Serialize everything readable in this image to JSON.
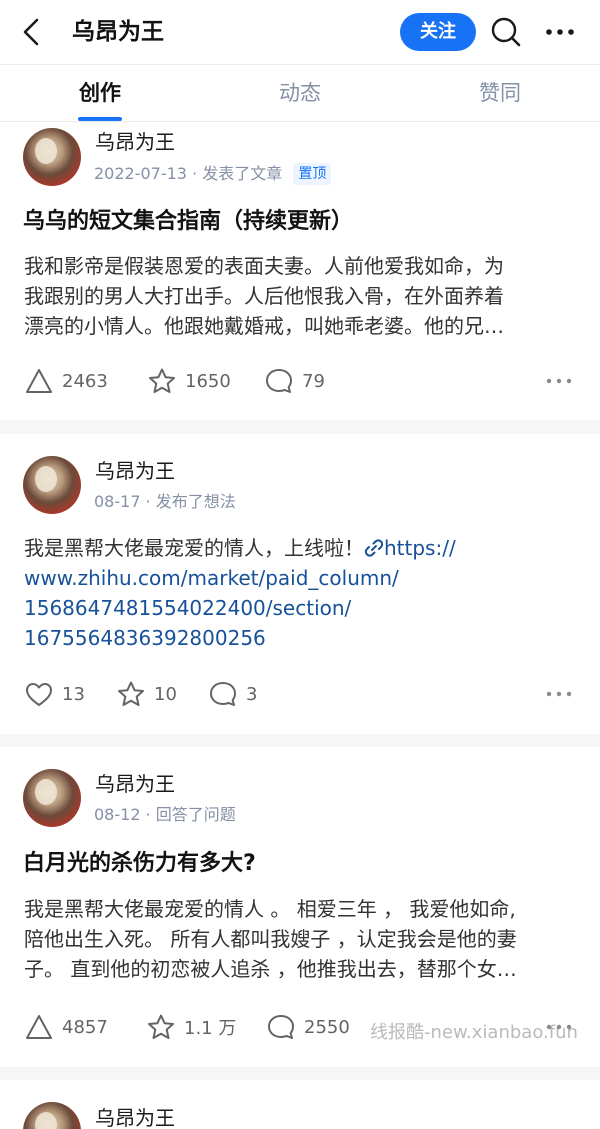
{
  "header": {
    "title": "乌昂为王",
    "follow_label": "关注",
    "icons": {
      "back": "back-arrow-icon",
      "search": "search-icon",
      "more": "more-dots-icon"
    }
  },
  "tabs": [
    {
      "label": "创作",
      "active": true
    },
    {
      "label": "动态",
      "active": false
    },
    {
      "label": "赞同",
      "active": false
    }
  ],
  "colors": {
    "accent": "#1772f6",
    "link": "#175199",
    "meta": "#8590a6"
  },
  "feed": [
    {
      "author": "乌昂为王",
      "date": "2022-07-13",
      "action": "发表了文章",
      "badge": "置顶",
      "title": "乌乌的短文集合指南（持续更新）",
      "excerpt_lines": [
        "我和影帝是假装恩爱的表面夫妻。人前他爱我如命，为",
        "我跟别的男人大打出手。人后他恨我入骨，在外面养着",
        "漂亮的小情人。他跟她戴婚戒，叫她乖老婆。他的兄…"
      ],
      "stats": {
        "primary_icon": "upvote-triangle-icon",
        "primary": "2463",
        "collect": "1650",
        "comment": "79"
      }
    },
    {
      "author": "乌昂为王",
      "date": "08-17",
      "action": "发布了想法",
      "text_prefix": "我是黑帮大佬最宠爱的情人，上线啦！",
      "link_lines": [
        "https://",
        "www.zhihu.com/market/paid_column/",
        "1568647481554022400/section/",
        "1675564836392800256"
      ],
      "stats": {
        "primary_icon": "heart-icon",
        "primary": "13",
        "collect": "10",
        "comment": "3"
      }
    },
    {
      "author": "乌昂为王",
      "date": "08-12",
      "action": "回答了问题",
      "title": "白月光的杀伤力有多大?",
      "excerpt_lines": [
        "我是黑帮大佬最宠爱的情人 。 相爱三年 ， 我爱他如命,",
        "陪他出生入死。 所有人都叫我嫂子 ，认定我会是他的妻",
        "子。 直到他的初恋被人追杀 ，他推我出去，替那个女…"
      ],
      "stats": {
        "primary_icon": "upvote-triangle-icon",
        "primary": "4857",
        "collect": "1.1 万",
        "comment": "2550"
      }
    },
    {
      "author": "乌昂为王"
    }
  ],
  "watermark": "线报酷-new.xianbao.fun"
}
